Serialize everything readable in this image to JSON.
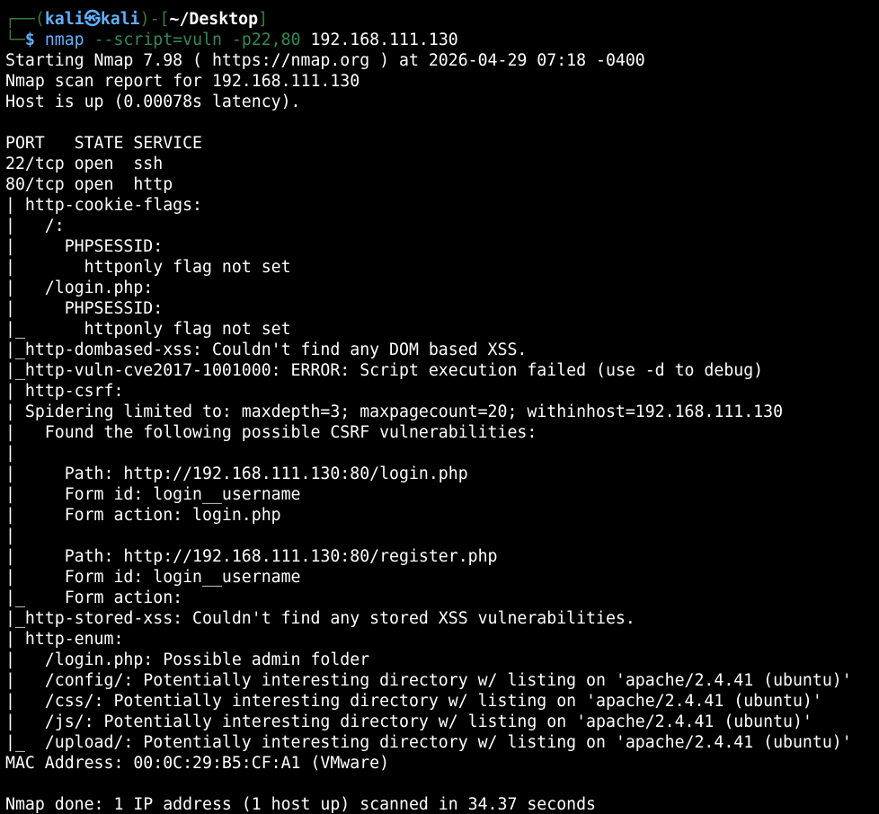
{
  "colors": {
    "background": "#000000",
    "text": "#ffffff",
    "prompt_frame": "#3a7a3a",
    "prompt_user": "#5fb0ff",
    "command_args": "#2e8b57"
  },
  "prompt": {
    "frame_top": "┌──(",
    "user": "kali",
    "at_symbol": "㉿",
    "host": "kali",
    "mid_bracket": ")-[",
    "cwd": "~/Desktop",
    "close_bracket": "]",
    "frame_bottom": "└─",
    "dollar": "$",
    "command": "nmap",
    "command_args": "--script=vuln -p22,80",
    "command_target": "192.168.111.130"
  },
  "output": [
    "Starting Nmap 7.98 ( https://nmap.org ) at 2026-04-29 07:18 -0400",
    "Nmap scan report for 192.168.111.130",
    "Host is up (0.00078s latency).",
    "",
    "PORT   STATE SERVICE",
    "22/tcp open  ssh",
    "80/tcp open  http",
    "| http-cookie-flags: ",
    "|   /: ",
    "|     PHPSESSID: ",
    "|       httponly flag not set",
    "|   /login.php: ",
    "|     PHPSESSID: ",
    "|_      httponly flag not set",
    "|_http-dombased-xss: Couldn't find any DOM based XSS.",
    "|_http-vuln-cve2017-1001000: ERROR: Script execution failed (use -d to debug)",
    "| http-csrf: ",
    "| Spidering limited to: maxdepth=3; maxpagecount=20; withinhost=192.168.111.130",
    "|   Found the following possible CSRF vulnerabilities: ",
    "|     ",
    "|     Path: http://192.168.111.130:80/login.php",
    "|     Form id: login__username",
    "|     Form action: login.php",
    "|     ",
    "|     Path: http://192.168.111.130:80/register.php",
    "|     Form id: login__username",
    "|_    Form action: ",
    "|_http-stored-xss: Couldn't find any stored XSS vulnerabilities.",
    "| http-enum: ",
    "|   /login.php: Possible admin folder",
    "|   /config/: Potentially interesting directory w/ listing on 'apache/2.4.41 (ubuntu)'",
    "|   /css/: Potentially interesting directory w/ listing on 'apache/2.4.41 (ubuntu)'",
    "|   /js/: Potentially interesting directory w/ listing on 'apache/2.4.41 (ubuntu)'",
    "|_  /upload/: Potentially interesting directory w/ listing on 'apache/2.4.41 (ubuntu)'",
    "MAC Address: 00:0C:29:B5:CF:A1 (VMware)",
    "",
    "Nmap done: 1 IP address (1 host up) scanned in 34.37 seconds"
  ]
}
